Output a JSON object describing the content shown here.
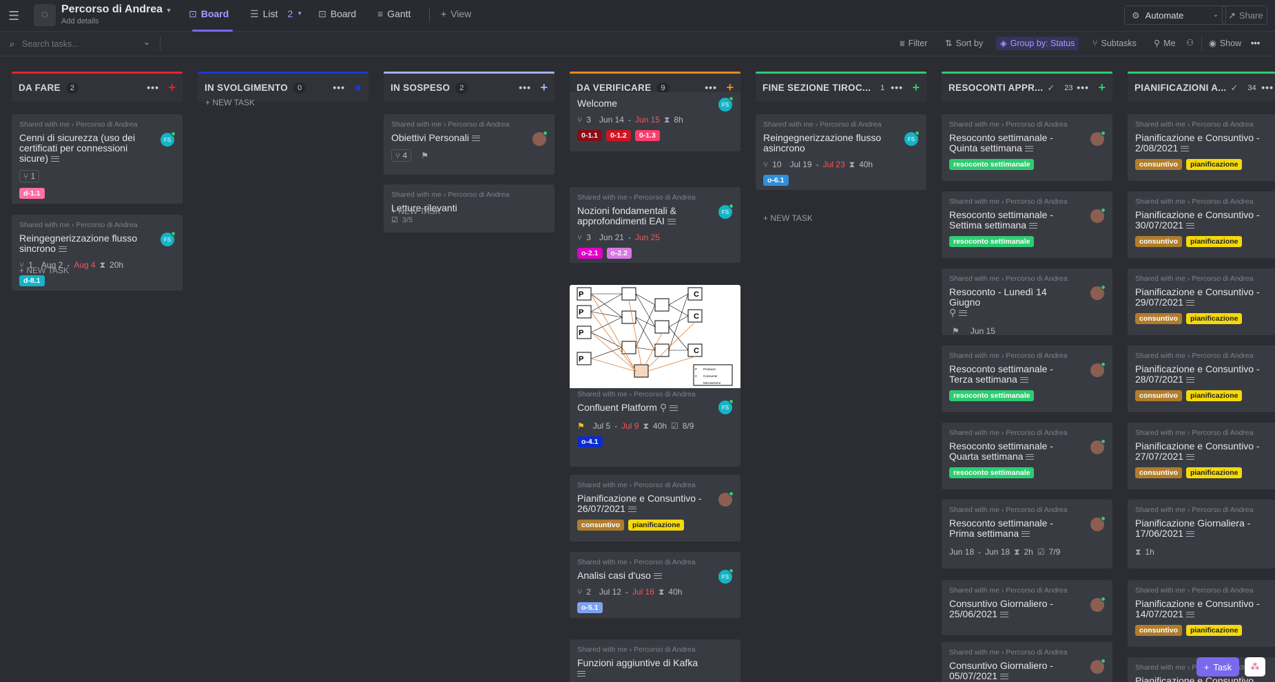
{
  "header": {
    "title": "Percorso di Andrea",
    "subtitle": "Add details",
    "tabs": [
      {
        "label": "Board"
      },
      {
        "label": "List",
        "count": "2"
      },
      {
        "label": "Board"
      },
      {
        "label": "Gantt"
      },
      {
        "label": "View"
      }
    ],
    "automate": "Automate",
    "share": "Share"
  },
  "toolbar": {
    "search_placeholder": "Search tasks...",
    "filter": "Filter",
    "sort": "Sort by",
    "group": "Group by: Status",
    "subtasks": "Subtasks",
    "me": "Me",
    "show": "Show"
  },
  "new_task": "+ NEW TASK",
  "crumb": "Shared with me  ›  Percorso di Andrea",
  "columns": [
    {
      "name": "DA FARE",
      "count": "2",
      "color": "#e5222f"
    },
    {
      "name": "IN SVOLGIMENTO",
      "count": "0",
      "color": "#1b3ad1"
    },
    {
      "name": "IN SOSPESO",
      "count": "2",
      "color": "#a2b4f5"
    },
    {
      "name": "DA VERIFICARE",
      "count": "9",
      "color": "#f2881c"
    },
    {
      "name": "FINE SEZIONE TIROC...",
      "count": "1",
      "color": "#2ecc71"
    },
    {
      "name": "RESOCONTI APPR...",
      "count": "23",
      "color": "#2ecc71"
    },
    {
      "name": "PIANIFICAZIONI A...",
      "count": "34",
      "color": "#2ecc71"
    }
  ],
  "cards": {
    "c1": {
      "title": "Cenni di sicurezza (uso dei certificati per connessioni sicure)",
      "subtasks": "1",
      "tag": "d-1.1"
    },
    "c2": {
      "title": "Reingegnerizzazione flusso sincrono",
      "subtasks": "1",
      "start": "Aug 2",
      "due": "Aug 4",
      "est": "20h",
      "tag": "d-8.1"
    },
    "c3": {
      "title": "Obiettivi Personali",
      "subtasks": "4"
    },
    "c4": {
      "title": "Letture rilevanti",
      "checklist": "3/5"
    },
    "c5": {
      "title": "Welcome",
      "subtasks": "3",
      "start": "Jun 14",
      "due": "Jun 15",
      "est": "8h",
      "tags": [
        "0-1.1",
        "0-1.2",
        "0-1.3"
      ]
    },
    "c6": {
      "title": "Nozioni fondamentali & approfondimenti EAI",
      "subtasks": "3",
      "start": "Jun 21",
      "due": "Jun 25",
      "tags": [
        "o-2.1",
        "o-2.2"
      ]
    },
    "c7": {
      "title": "Confluent Platform",
      "start": "Jul 5",
      "due": "Jul 9",
      "est": "40h",
      "checklist": "8/9",
      "tag": "o-4.1"
    },
    "c8": {
      "title": "Pianificazione e Consuntivo - 26/07/2021",
      "tags": [
        "consuntivo",
        "pianificazione"
      ]
    },
    "c9": {
      "title": "Analisi casi d'uso",
      "subtasks": "2",
      "start": "Jul 12",
      "due": "Jul 16",
      "est": "40h",
      "tag": "o-5.1"
    },
    "c10": {
      "title": "Funzioni aggiuntive di Kafka"
    },
    "c11": {
      "title": "Reingegnerizzazione flusso asincrono",
      "subtasks": "10",
      "start": "Jul 19",
      "due": "Jul 23",
      "est": "40h",
      "tag": "o-6.1"
    },
    "r1": {
      "title": "Resoconto settimanale - Quinta settimana",
      "tag": "resoconto settimanale"
    },
    "r2": {
      "title": "Resoconto settimanale - Settima settimana",
      "tag": "resoconto settimanale"
    },
    "r3": {
      "title": "Resoconto - Lunedì 14 Giugno",
      "date": "Jun 15"
    },
    "r4": {
      "title": "Resoconto settimanale - Terza settimana",
      "tag": "resoconto settimanale"
    },
    "r5": {
      "title": "Resoconto settimanale - Quarta settimana",
      "tag": "resoconto settimanale"
    },
    "r6": {
      "title": "Resoconto settimanale - Prima settimana",
      "start": "Jun 18",
      "due": "Jun 18",
      "est": "2h",
      "checklist": "7/9"
    },
    "r7": {
      "title": "Consuntivo Giornaliero - 25/06/2021"
    },
    "r8": {
      "title": "Consuntivo Giornaliero - 05/07/2021"
    },
    "p1": {
      "title": "Pianificazione e Consuntivo - 2/08/2021"
    },
    "p2": {
      "title": "Pianificazione e Consuntivo - 30/07/2021"
    },
    "p3": {
      "title": "Pianificazione e Consuntivo - 29/07/2021"
    },
    "p4": {
      "title": "Pianificazione e Consuntivo - 28/07/2021"
    },
    "p5": {
      "title": "Pianificazione e Consuntivo - 27/07/2021"
    },
    "p6": {
      "title": "Pianificazione Giornaliera - 17/06/2021",
      "est": "1h"
    },
    "p7": {
      "title": "Pianificazione e Consuntivo - 14/07/2021"
    },
    "p8": {
      "title": "Pianificazione e Consuntivo"
    }
  },
  "tag_consuntivo": "consuntivo",
  "tag_pianificazione": "pianificazione",
  "avatar_initials": "FS",
  "diagram": {
    "p": "P",
    "c": "C",
    "legend": [
      "P",
      "Producer",
      "C",
      "Consumer",
      "",
      "Microservice"
    ]
  },
  "fab": {
    "task": "Task"
  },
  "colors": {
    "accent": "#7b68ee",
    "green": "#2ecc71",
    "consuntivo": "#b07d2b",
    "pianificazione": "#f5d90a"
  }
}
